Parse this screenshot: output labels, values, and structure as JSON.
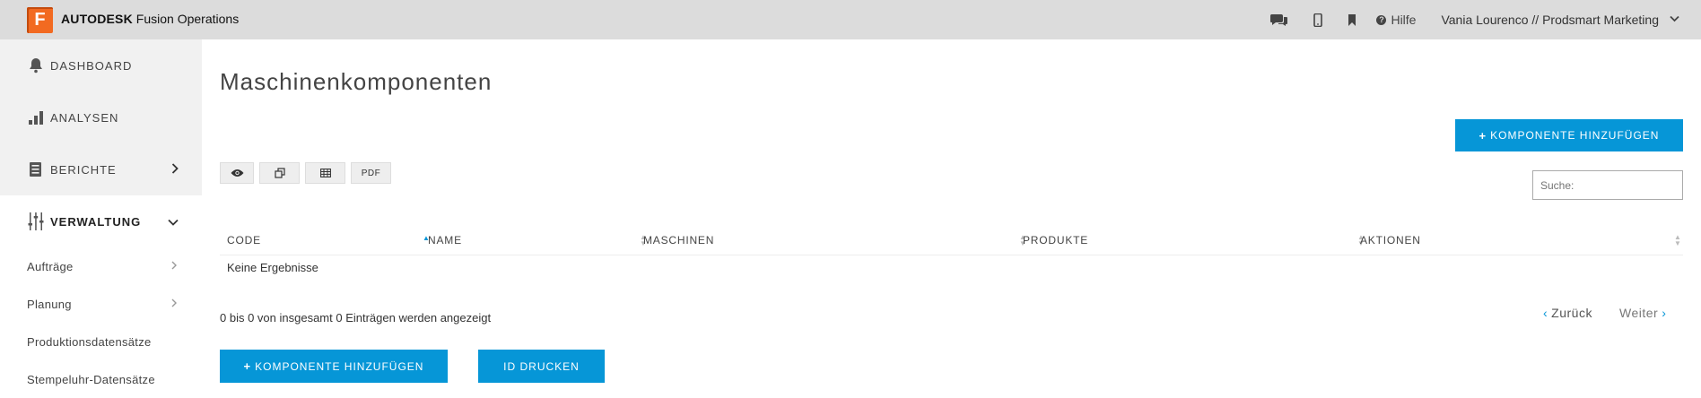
{
  "brand": {
    "logo_letter": "F",
    "name_bold": "AUTODESK",
    "name_rest": "Fusion Operations",
    "accent": "#f26a21"
  },
  "topbar": {
    "icons": [
      "chat-icon",
      "mobile-icon",
      "bookmark-icon"
    ],
    "help_label": "Hilfe",
    "user_label": "Vania Lourenco // Prodsmart Marketing"
  },
  "sidebar": {
    "items": [
      {
        "label": "DASHBOARD",
        "icon": "bell-icon"
      },
      {
        "label": "ANALYSEN",
        "icon": "bar-chart-icon"
      },
      {
        "label": "BERICHTE",
        "icon": "report-icon"
      },
      {
        "label": "VERWALTUNG",
        "icon": "sliders-icon"
      }
    ],
    "subitems": [
      {
        "label": "Aufträge"
      },
      {
        "label": "Planung"
      },
      {
        "label": "Produktionsdatensätze"
      },
      {
        "label": "Stempeluhr-Datensätze"
      }
    ]
  },
  "main": {
    "title": "Maschinenkomponenten",
    "add_button": "KOMPONENTE HINZUFÜGEN",
    "tool_pdf": "PDF",
    "search_placeholder": "Suche:",
    "columns": [
      "CODE",
      "NAME",
      "MASCHINEN",
      "PRODUKTE",
      "AKTIONEN"
    ],
    "empty_text": "Keine Ergebnisse",
    "info_text": "0 bis 0 von insgesamt 0 Einträgen werden angezeigt",
    "prev_label": "Zurück",
    "next_label": "Weiter",
    "print_button": "ID DRUCKEN"
  },
  "colors": {
    "primary": "#0696d7",
    "topbar": "#dcdcdc",
    "sidebar": "#f1f1f1"
  }
}
